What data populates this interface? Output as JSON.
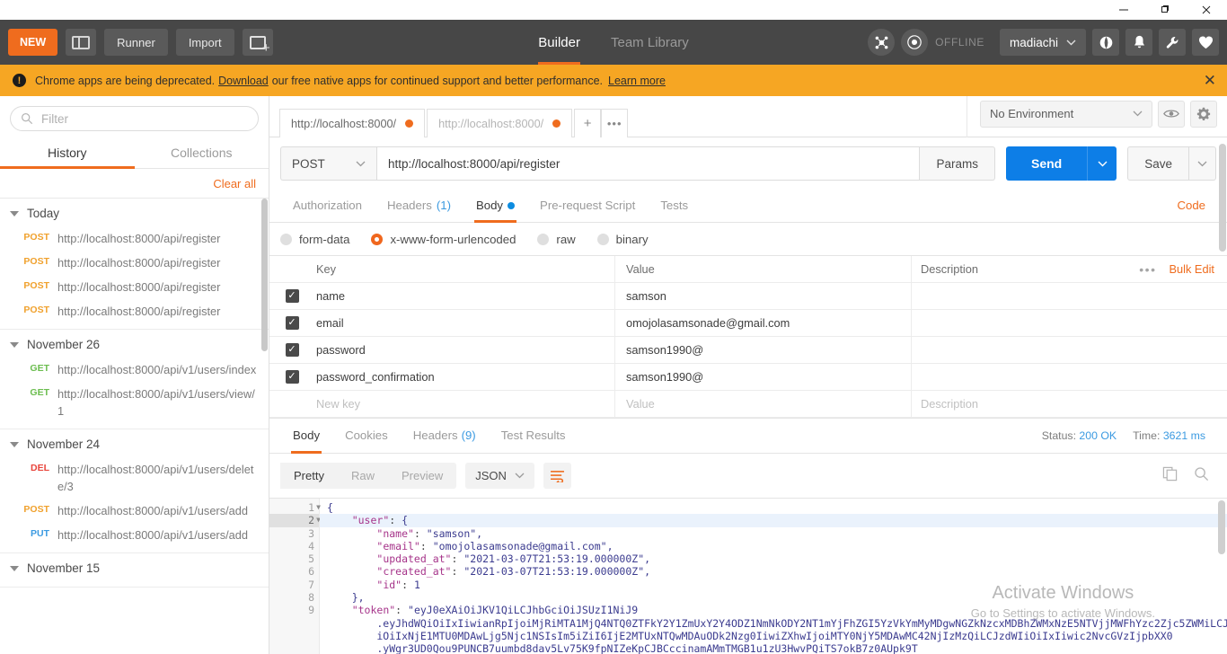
{
  "window": {
    "minimize": "—",
    "maximize": "❐",
    "close": "✕"
  },
  "header": {
    "new_label": "NEW",
    "sidebar_toggle_name": "sidebar-toggle",
    "runner_label": "Runner",
    "import_label": "Import",
    "new_tab_label": "",
    "tabs": [
      {
        "label": "Builder",
        "active": true
      },
      {
        "label": "Team Library",
        "active": false
      }
    ],
    "sync_status": "OFFLINE",
    "user": "madiachi",
    "user_caret": "⌄"
  },
  "banner": {
    "text_before": "Chrome apps are being deprecated.",
    "link1": "Download",
    "text_middle": "our free native apps for continued support and better performance.",
    "link2": "Learn more",
    "close": "✕"
  },
  "sidebar": {
    "filter_placeholder": "Filter",
    "tabs": [
      {
        "label": "History",
        "active": true
      },
      {
        "label": "Collections",
        "active": false
      }
    ],
    "clear_all": "Clear all",
    "groups": [
      {
        "title": "Today",
        "items": [
          {
            "method": "POST",
            "url": "http://localhost:8000/api/register"
          },
          {
            "method": "POST",
            "url": "http://localhost:8000/api/register"
          },
          {
            "method": "POST",
            "url": "http://localhost:8000/api/register"
          },
          {
            "method": "POST",
            "url": "http://localhost:8000/api/register"
          }
        ]
      },
      {
        "title": "November 26",
        "items": [
          {
            "method": "GET",
            "url": "http://localhost:8000/api/v1/users/index"
          },
          {
            "method": "GET",
            "url": "http://localhost:8000/api/v1/users/view/1"
          }
        ]
      },
      {
        "title": "November 24",
        "items": [
          {
            "method": "DEL",
            "url": "http://localhost:8000/api/v1/users/delete/3"
          },
          {
            "method": "POST",
            "url": "http://localhost:8000/api/v1/users/add"
          },
          {
            "method": "PUT",
            "url": "http://localhost:8000/api/v1/users/add"
          }
        ]
      },
      {
        "title": "November 15",
        "items": []
      }
    ]
  },
  "request_tabs": [
    {
      "label": "http://localhost:8000/",
      "active": true
    },
    {
      "label": "http://localhost:8000/",
      "active": false
    }
  ],
  "tabbar": {
    "plus": "+",
    "more": "•••"
  },
  "environment": {
    "selected": "No Environment",
    "caret": "⌄"
  },
  "url_row": {
    "method": "POST",
    "method_caret": "⌄",
    "url": "http://localhost:8000/api/register",
    "params_label": "Params",
    "send_label": "Send",
    "send_caret": "⌄",
    "save_label": "Save",
    "save_caret": "⌄"
  },
  "request": {
    "tabs": [
      {
        "label": "Authorization",
        "active": false,
        "count": "",
        "dot": false
      },
      {
        "label": "Headers",
        "active": false,
        "count": "(1)",
        "dot": false
      },
      {
        "label": "Body",
        "active": true,
        "count": "",
        "dot": true
      },
      {
        "label": "Pre-request Script",
        "active": false,
        "count": "",
        "dot": false
      },
      {
        "label": "Tests",
        "active": false,
        "count": "",
        "dot": false
      }
    ],
    "code_link": "Code",
    "body_types": [
      {
        "label": "form-data",
        "selected": false
      },
      {
        "label": "x-www-form-urlencoded",
        "selected": true
      },
      {
        "label": "raw",
        "selected": false
      },
      {
        "label": "binary",
        "selected": false
      }
    ],
    "table": {
      "headers": {
        "key": "Key",
        "value": "Value",
        "description": "Description"
      },
      "dots": "•••",
      "bulk_edit": "Bulk Edit",
      "rows": [
        {
          "checked": true,
          "key": "name",
          "value": "samson",
          "description": ""
        },
        {
          "checked": true,
          "key": "email",
          "value": "omojolasamsonade@gmail.com",
          "description": ""
        },
        {
          "checked": true,
          "key": "password",
          "value": "samson1990@",
          "description": ""
        },
        {
          "checked": true,
          "key": "password_confirmation",
          "value": "samson1990@",
          "description": ""
        }
      ],
      "empty_row": {
        "key": "New key",
        "value": "Value",
        "description": "Description"
      }
    }
  },
  "response": {
    "tabs": [
      {
        "label": "Body",
        "active": true,
        "count": ""
      },
      {
        "label": "Cookies",
        "active": false,
        "count": ""
      },
      {
        "label": "Headers",
        "active": false,
        "count": "(9)"
      },
      {
        "label": "Test Results",
        "active": false,
        "count": ""
      }
    ],
    "status_label": "Status:",
    "status_value": "200 OK",
    "time_label": "Time:",
    "time_value": "3621 ms",
    "view_modes": [
      {
        "label": "Pretty",
        "active": true
      },
      {
        "label": "Raw",
        "active": false
      },
      {
        "label": "Preview",
        "active": false
      }
    ],
    "format": "JSON",
    "format_caret": "⌄",
    "lines": [
      {
        "n": "1",
        "fold": true,
        "highlight": false,
        "text": "{"
      },
      {
        "n": "2",
        "fold": true,
        "highlight": true,
        "text": "    \"user\": {"
      },
      {
        "n": "3",
        "fold": false,
        "highlight": false,
        "text": "        \"name\": \"samson\","
      },
      {
        "n": "4",
        "fold": false,
        "highlight": false,
        "text": "        \"email\": \"omojolasamsonade@gmail.com\","
      },
      {
        "n": "5",
        "fold": false,
        "highlight": false,
        "text": "        \"updated_at\": \"2021-03-07T21:53:19.000000Z\","
      },
      {
        "n": "6",
        "fold": false,
        "highlight": false,
        "text": "        \"created_at\": \"2021-03-07T21:53:19.000000Z\","
      },
      {
        "n": "7",
        "fold": false,
        "highlight": false,
        "text": "        \"id\": 1"
      },
      {
        "n": "8",
        "fold": false,
        "highlight": false,
        "text": "    },"
      },
      {
        "n": "9",
        "fold": false,
        "highlight": false,
        "text": "    \"token\": \"eyJ0eXAiOiJKV1QiLCJhbGciOiJSUzI1NiJ9"
      },
      {
        "n": "",
        "fold": false,
        "highlight": false,
        "text": "        .eyJhdWQiOiIxIiwianRpIjoiMjRiMTA1MjQ4NTQ0ZTFkY2Y1ZmUxY2Y4ODZ1NmNkODY2NT1mYjFhZGI5YzVkYmMyMDgwNGZkNzcxMDBhZWMxNzE5NTVjjMWFhYzc2Zjc5ZWMiLCJpYXQQ"
      },
      {
        "n": "",
        "fold": false,
        "highlight": false,
        "text": "        iOiIxNjE1MTU0MDAwLjg5Njc1NSIsIm5iZiI6IjE2MTUxNTQwMDAuODk2Nzg0IiwiZXhwIjoiMTY0NjY5MDAwMC42NjIzMzQiLCJzdWIiOiIxIiwic2NvcGVzIjpbXX0"
      },
      {
        "n": "",
        "fold": false,
        "highlight": false,
        "text": "        .yWgr3UD0Qou9PUNCB7uumbd8dav5Lv75K9fpNIZeKpCJBCccinamAMmTMGB1u1zU3HwvPQiTS7okB7z0AUpk9T"
      }
    ]
  },
  "watermark": {
    "title": "Activate Windows",
    "subtitle": "Go to Settings to activate Windows."
  }
}
